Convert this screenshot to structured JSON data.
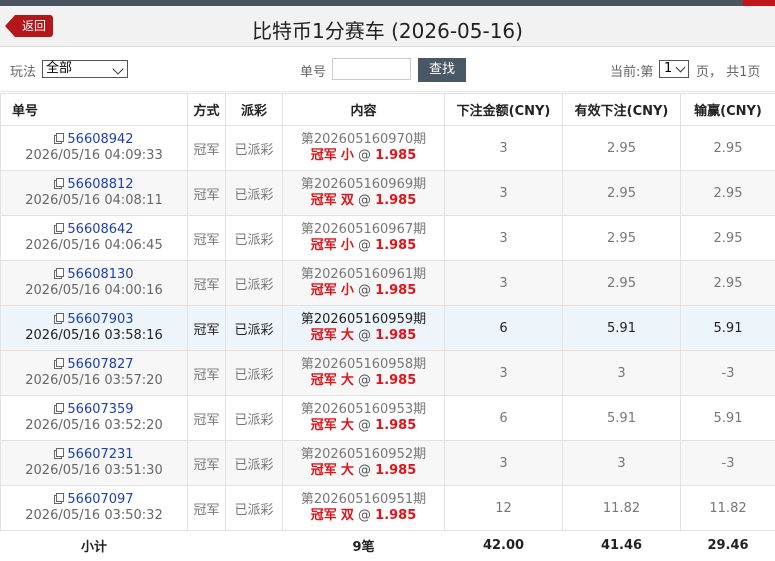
{
  "header": {
    "back_label": "返回",
    "title": "比特币1分赛车 (2026-05-16)"
  },
  "filter": {
    "play_label": "玩法",
    "play_selected": "全部",
    "order_label": "单号",
    "order_value": "",
    "search_label": "查找",
    "page_prefix": "当前:第",
    "page_selected": "1",
    "page_suffix": "页， 共1页"
  },
  "table": {
    "headers": [
      "单号",
      "方式",
      "派彩",
      "内容",
      "下注金额(CNY)",
      "有效下注(CNY)",
      "输赢(CNY)"
    ],
    "rows": [
      {
        "order": "56608942",
        "time": "2026/05/16 04:09:33",
        "method": "冠军",
        "status": "已派彩",
        "issue": "第202605160970期",
        "bet_type": "冠军",
        "bet_pick": "小",
        "at": "@",
        "odds": "1.985",
        "amount": "3",
        "valid": "2.95",
        "winloss": "2.95"
      },
      {
        "order": "56608812",
        "time": "2026/05/16 04:08:11",
        "method": "冠军",
        "status": "已派彩",
        "issue": "第202605160969期",
        "bet_type": "冠军",
        "bet_pick": "双",
        "at": "@",
        "odds": "1.985",
        "amount": "3",
        "valid": "2.95",
        "winloss": "2.95"
      },
      {
        "order": "56608642",
        "time": "2026/05/16 04:06:45",
        "method": "冠军",
        "status": "已派彩",
        "issue": "第202605160967期",
        "bet_type": "冠军",
        "bet_pick": "小",
        "at": "@",
        "odds": "1.985",
        "amount": "3",
        "valid": "2.95",
        "winloss": "2.95"
      },
      {
        "order": "56608130",
        "time": "2026/05/16 04:00:16",
        "method": "冠军",
        "status": "已派彩",
        "issue": "第202605160961期",
        "bet_type": "冠军",
        "bet_pick": "小",
        "at": "@",
        "odds": "1.985",
        "amount": "3",
        "valid": "2.95",
        "winloss": "2.95"
      },
      {
        "order": "56607903",
        "time": "2026/05/16 03:58:16",
        "method": "冠军",
        "status": "已派彩",
        "issue": "第202605160959期",
        "bet_type": "冠军",
        "bet_pick": "大",
        "at": "@",
        "odds": "1.985",
        "amount": "6",
        "valid": "5.91",
        "winloss": "5.91"
      },
      {
        "order": "56607827",
        "time": "2026/05/16 03:57:20",
        "method": "冠军",
        "status": "已派彩",
        "issue": "第202605160958期",
        "bet_type": "冠军",
        "bet_pick": "大",
        "at": "@",
        "odds": "1.985",
        "amount": "3",
        "valid": "3",
        "winloss": "-3"
      },
      {
        "order": "56607359",
        "time": "2026/05/16 03:52:20",
        "method": "冠军",
        "status": "已派彩",
        "issue": "第202605160953期",
        "bet_type": "冠军",
        "bet_pick": "大",
        "at": "@",
        "odds": "1.985",
        "amount": "6",
        "valid": "5.91",
        "winloss": "5.91"
      },
      {
        "order": "56607231",
        "time": "2026/05/16 03:51:30",
        "method": "冠军",
        "status": "已派彩",
        "issue": "第202605160952期",
        "bet_type": "冠军",
        "bet_pick": "大",
        "at": "@",
        "odds": "1.985",
        "amount": "3",
        "valid": "3",
        "winloss": "-3"
      },
      {
        "order": "56607097",
        "time": "2026/05/16 03:50:32",
        "method": "冠军",
        "status": "已派彩",
        "issue": "第202605160951期",
        "bet_type": "冠军",
        "bet_pick": "双",
        "at": "@",
        "odds": "1.985",
        "amount": "12",
        "valid": "11.82",
        "winloss": "11.82"
      }
    ],
    "highlighted_row": 4,
    "footer": {
      "label": "小计",
      "count": "9笔",
      "amount": "42.00",
      "valid": "41.46",
      "winloss": "29.46"
    }
  },
  "colors": {
    "brand_red": "#b3171c",
    "accent_red": "#e0151b",
    "link_blue": "#1a3fb5",
    "button_dark": "#4a5866"
  },
  "icons": {
    "order_icon": "copy-document-icon",
    "back_icon": "back-arrow-icon"
  }
}
